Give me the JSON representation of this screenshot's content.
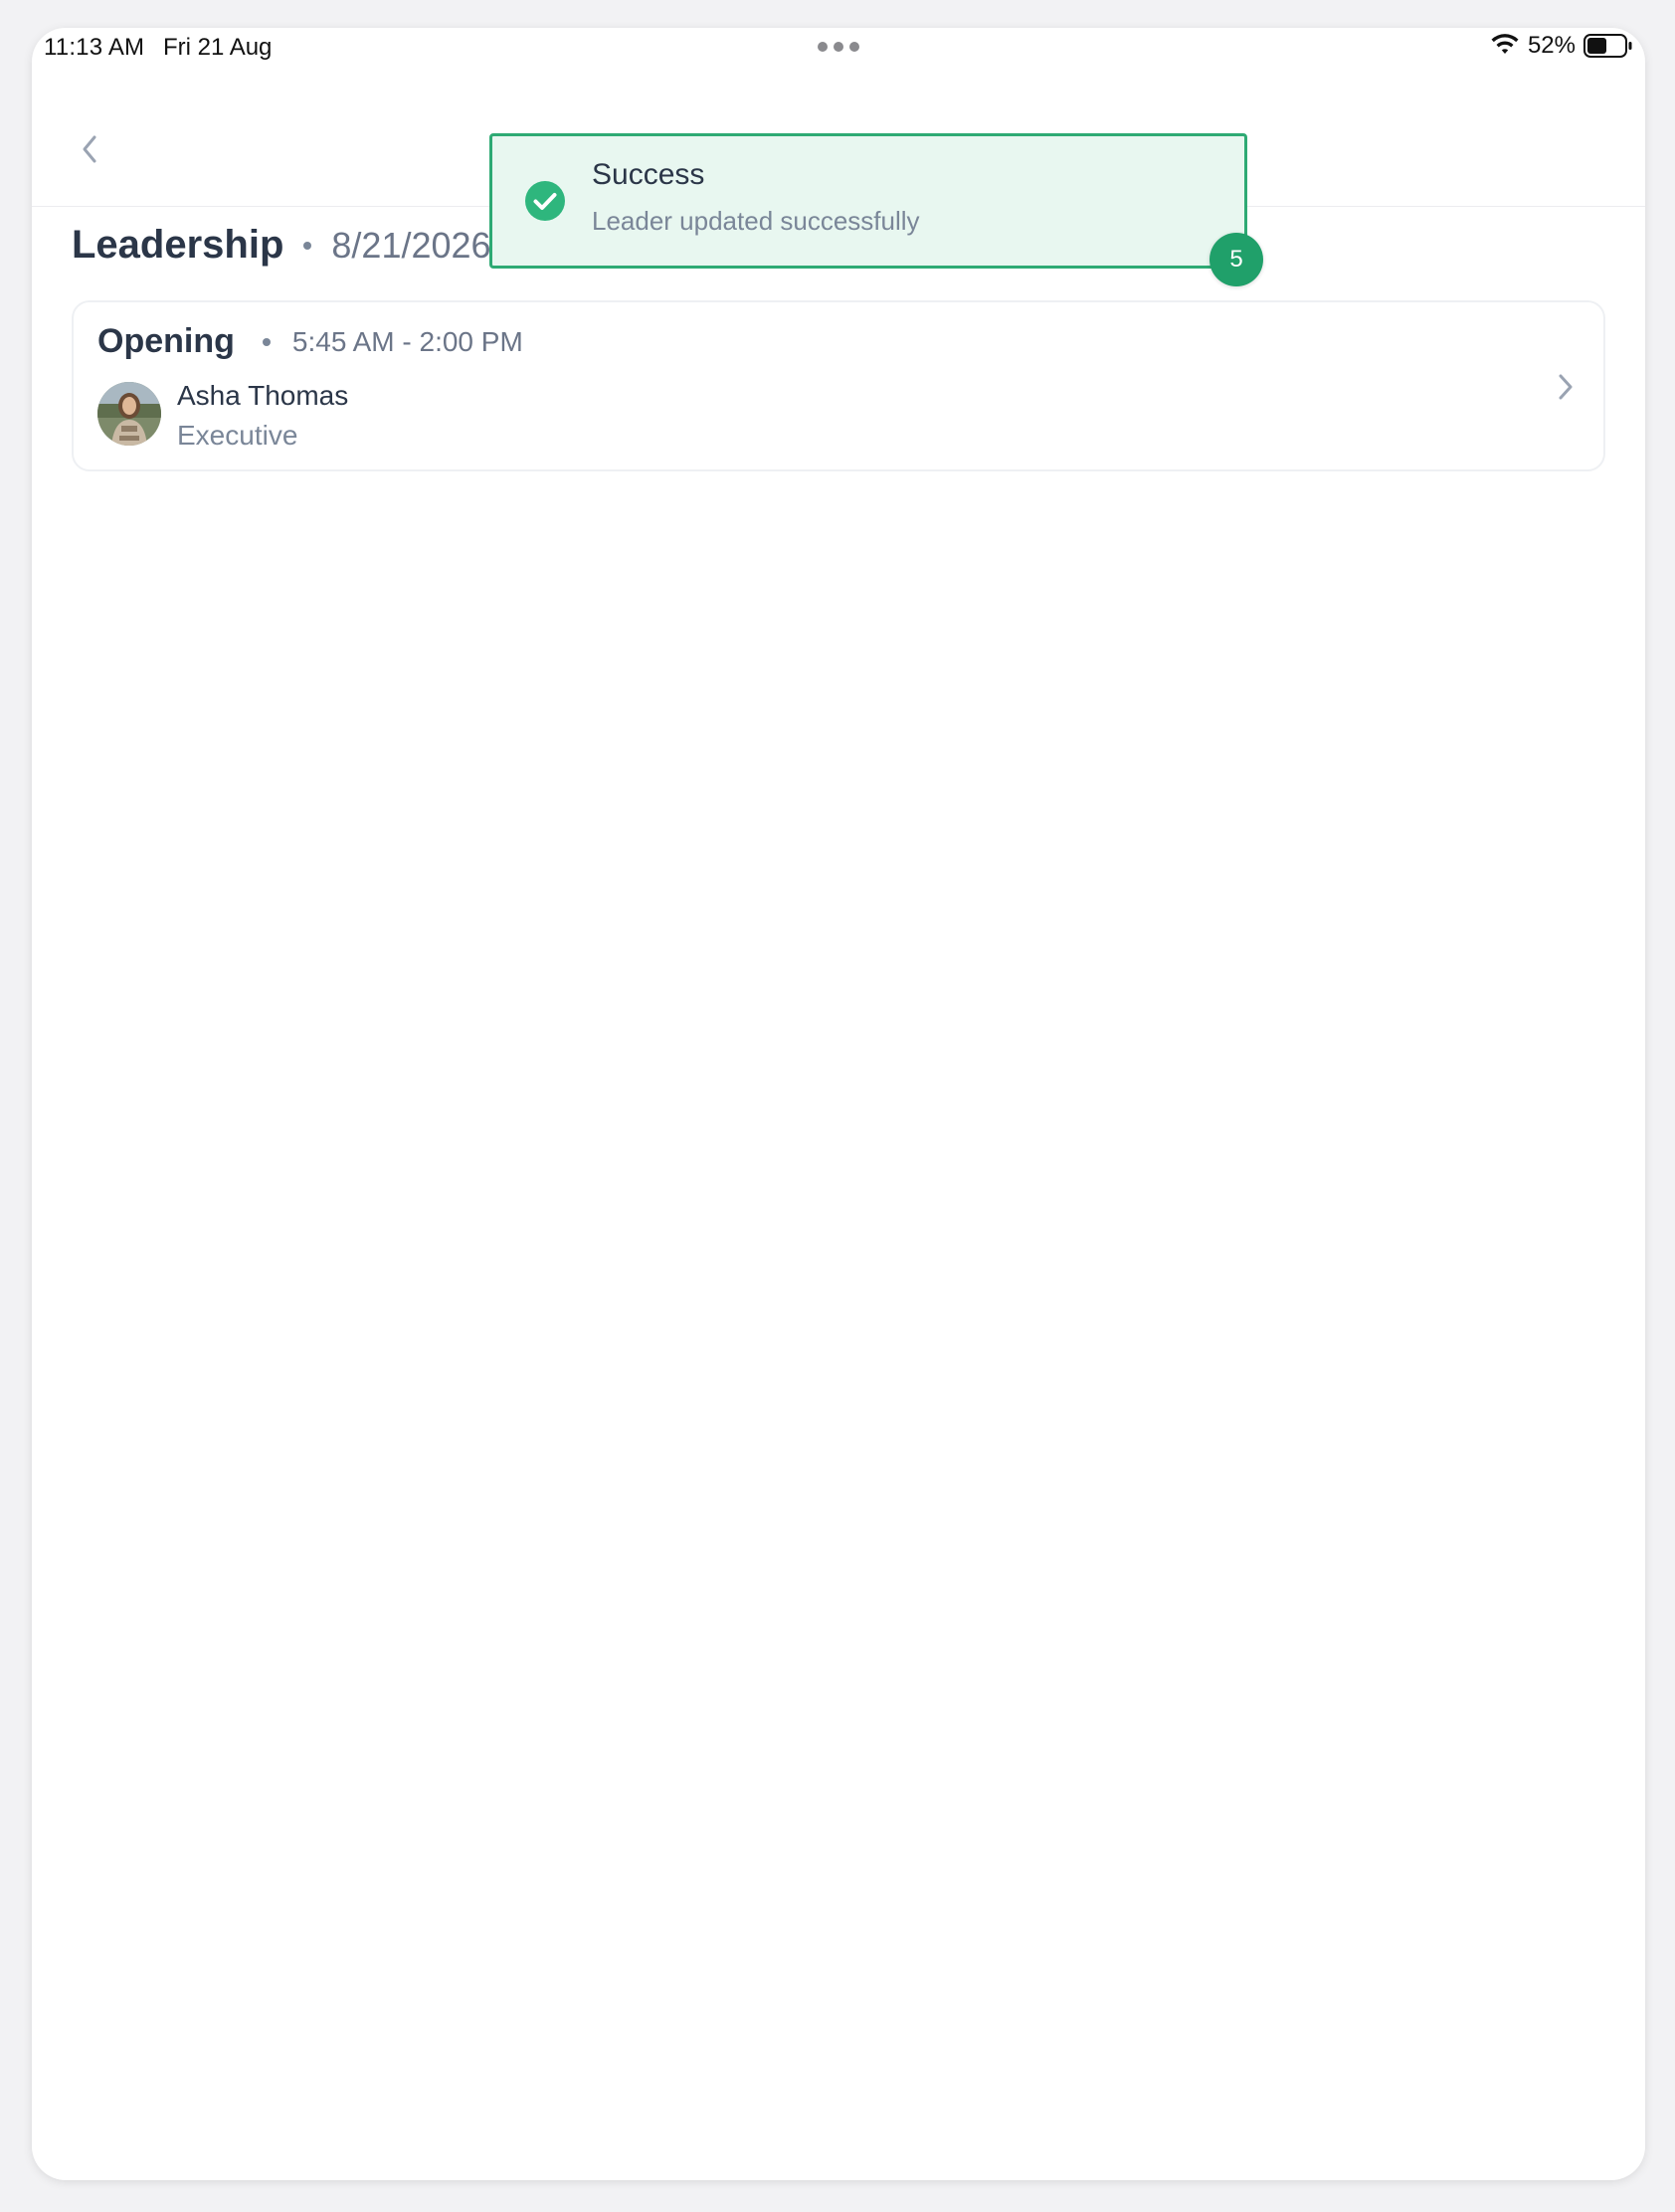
{
  "status_bar": {
    "time": "11:13 AM",
    "date": "Fri 21 Aug",
    "battery": "52%",
    "battery_level": 0.52
  },
  "nav": {
    "title": ""
  },
  "header": {
    "title": "Leadership",
    "date": "8/21/2026"
  },
  "shift": {
    "name": "Opening",
    "time": "5:45 AM - 2:00 PM",
    "person_name": "Asha Thomas",
    "person_role": "Executive"
  },
  "toast": {
    "title": "Success",
    "message": "Leader updated successfully",
    "badge_count": "5"
  },
  "colors": {
    "success_green": "#2eaa74",
    "toast_bg": "#e8f7f0",
    "text_primary": "#2b3648",
    "text_secondary": "#7a8698"
  }
}
